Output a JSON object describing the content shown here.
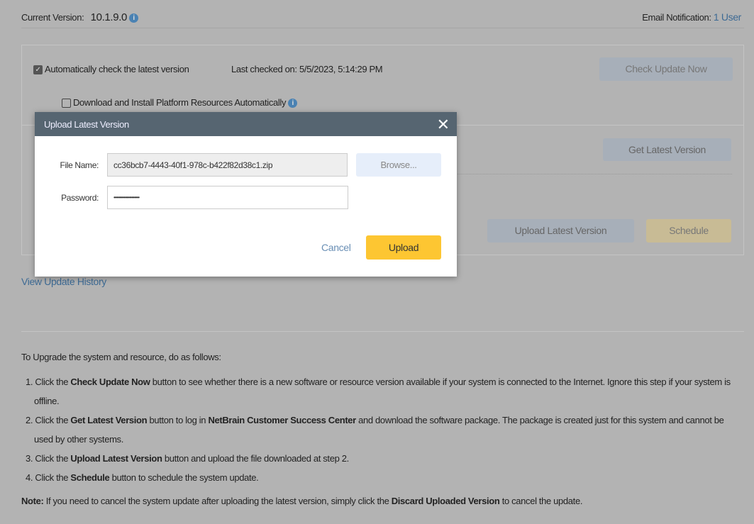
{
  "header": {
    "version_label": "Current Version:",
    "version_value": "10.1.9.0",
    "email_label": "Email Notification:",
    "email_link": "1 User"
  },
  "panel": {
    "auto_check_label": "Automatically check the latest version",
    "auto_check_checked": true,
    "last_checked": "Last checked on: 5/5/2023, 5:14:29 PM",
    "check_update_now": "Check Update Now",
    "download_install_label": "Download and Install Platform Resources Automatically",
    "download_install_checked": false,
    "get_latest_version": "Get Latest Version",
    "upload_latest_version": "Upload Latest Version",
    "schedule": "Schedule"
  },
  "view_history": "View Update History",
  "instructions": {
    "intro": "To Upgrade the system and resource, do as follows:",
    "steps": [
      [
        "1. Click the ",
        "Check Update Now",
        " button to see whether there is a new software or resource version available if your system is connected to the Internet. Ignore this step if your system is offline."
      ],
      [
        "2. Click the ",
        "Get Latest Version",
        " button to log in ",
        "NetBrain Customer Success Center",
        " and download the software package. The package is created just for this system and cannot be used by other systems."
      ],
      [
        "3. Click the ",
        "Upload Latest Version",
        " button and upload the file downloaded at step 2."
      ],
      [
        "4. Click the ",
        "Schedule",
        " button to schedule the system update."
      ]
    ],
    "note": [
      "Note:",
      " If you need to cancel the system update after uploading the latest version, simply click the ",
      "Discard Uploaded Version",
      " to cancel the update."
    ]
  },
  "dialog": {
    "title": "Upload Latest Version",
    "file_label": "File Name:",
    "file_value": "cc36bcb7-4443-40f1-978c-b422f82d38c1.zip",
    "browse": "Browse...",
    "password_label": "Password:",
    "password_value": "••••••••••••••••••••",
    "cancel": "Cancel",
    "upload": "Upload"
  }
}
